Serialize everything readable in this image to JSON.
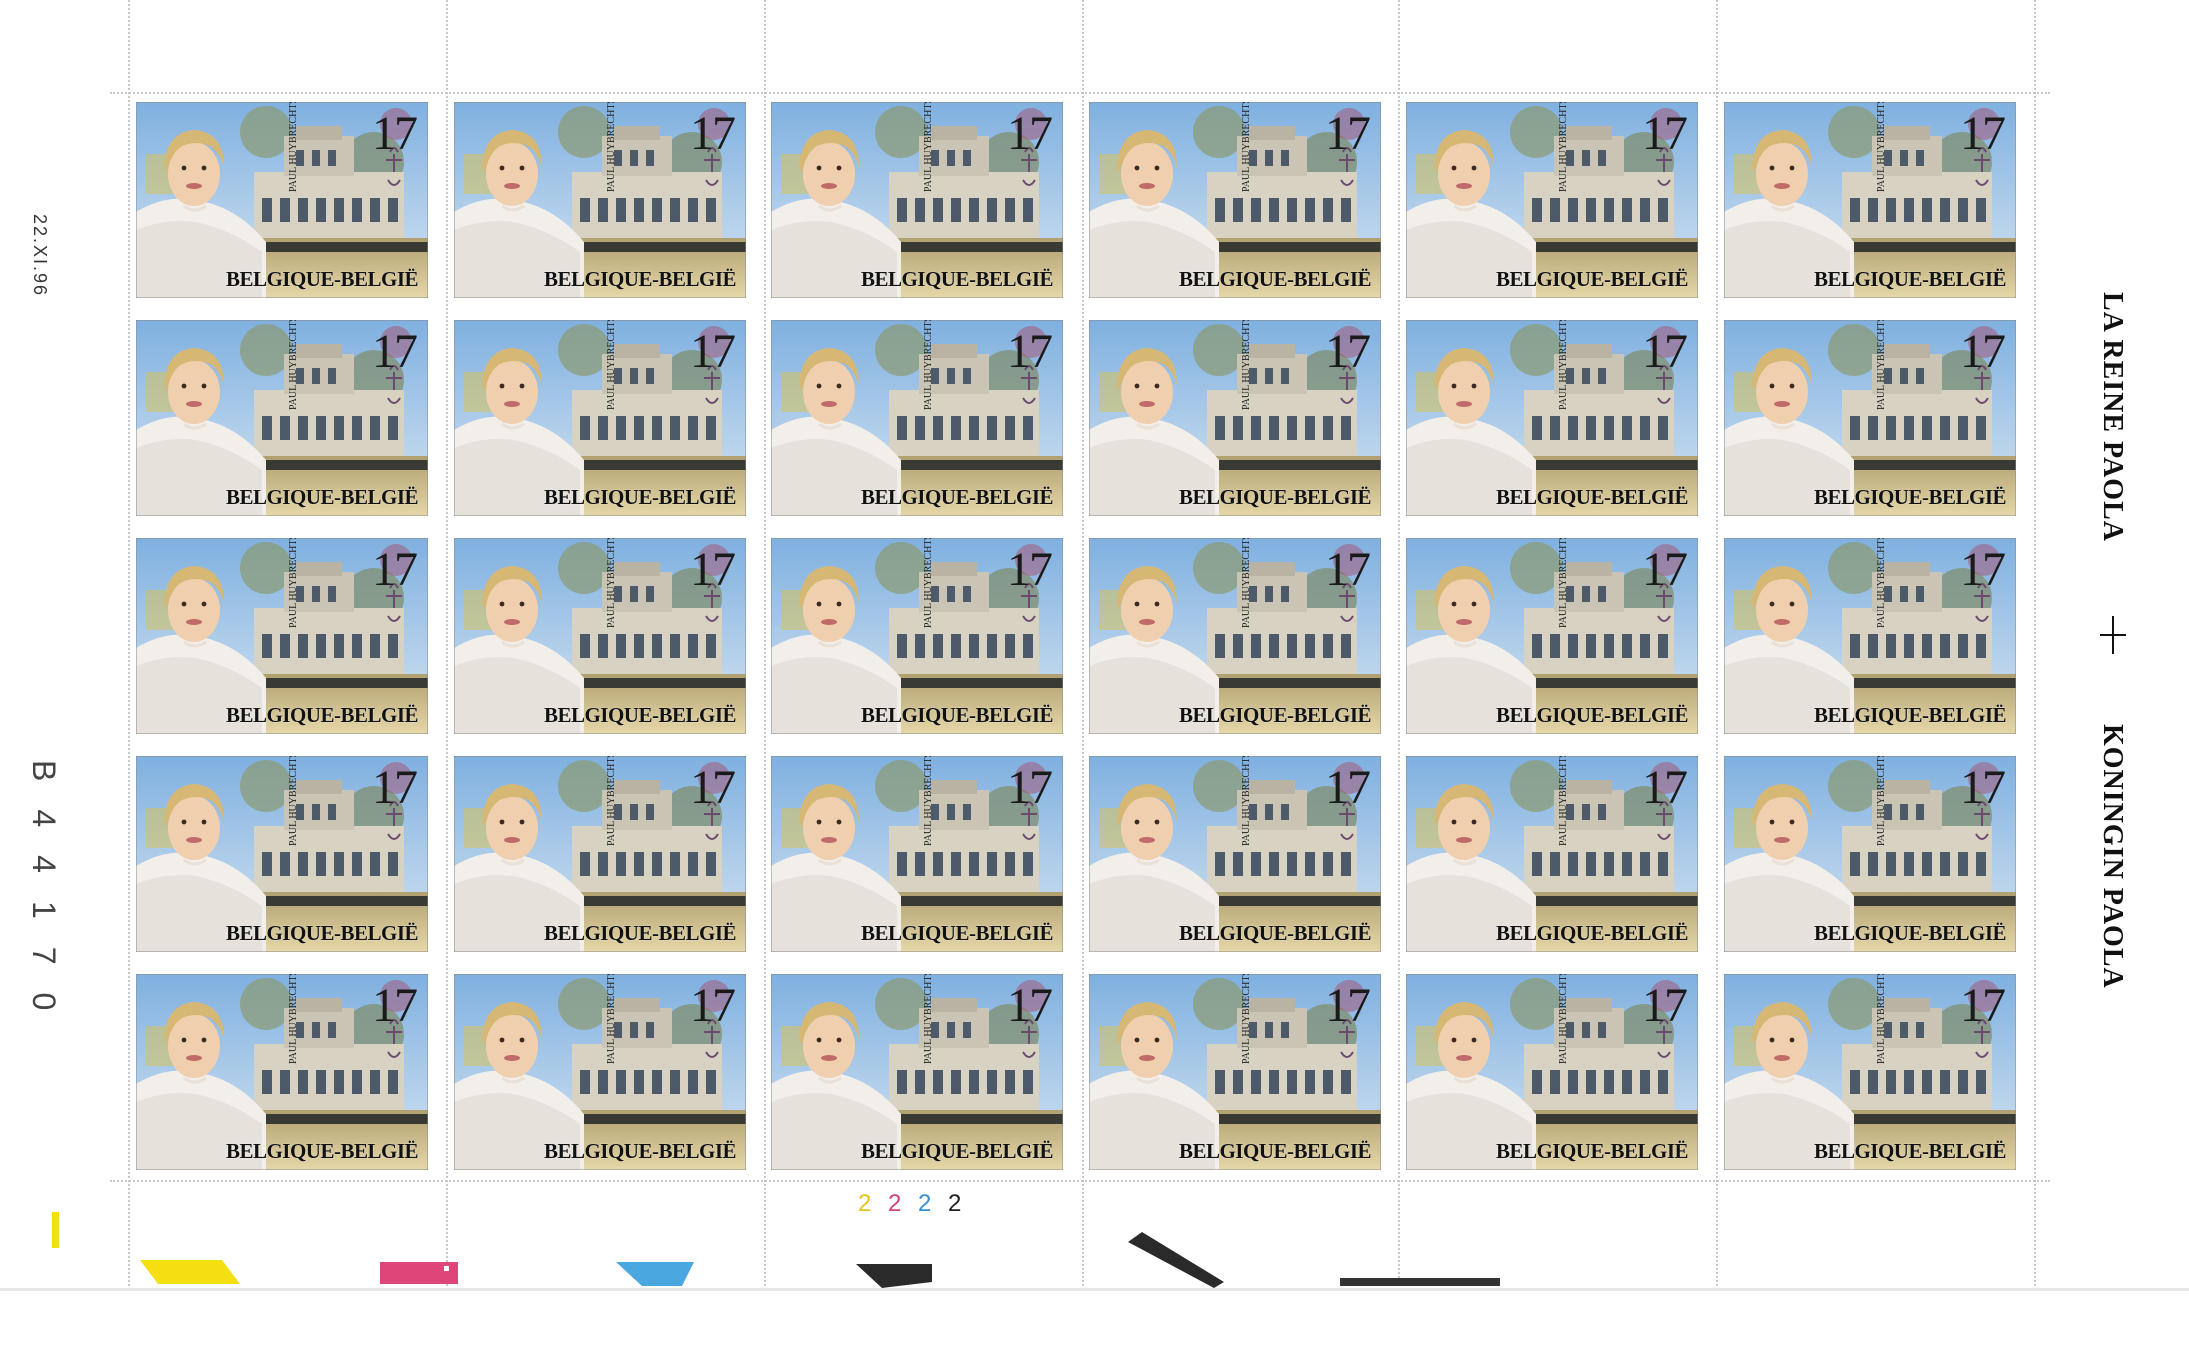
{
  "sheet": {
    "stamp_value": "17",
    "stamp_country": "BELGIQUE-BELGIË",
    "stamp_designer_mark": "PAUL HUYBRECHTS",
    "rows": 5,
    "columns": 6,
    "print_date": "22.XI.96",
    "sheet_number": "B44170",
    "margin_text_fr": "LA REINE PAOLA",
    "margin_text_nl": "KONINGIN PAOLA",
    "plate_numbers": [
      {
        "value": "2",
        "color": "#e6c21c"
      },
      {
        "value": "2",
        "color": "#d0437a"
      },
      {
        "value": "2",
        "color": "#3a8fd0"
      },
      {
        "value": "2",
        "color": "#222222"
      }
    ],
    "color_marks": [
      "#f5df12",
      "#e0457a",
      "#4aa7e0",
      "#2a2a2a"
    ]
  }
}
